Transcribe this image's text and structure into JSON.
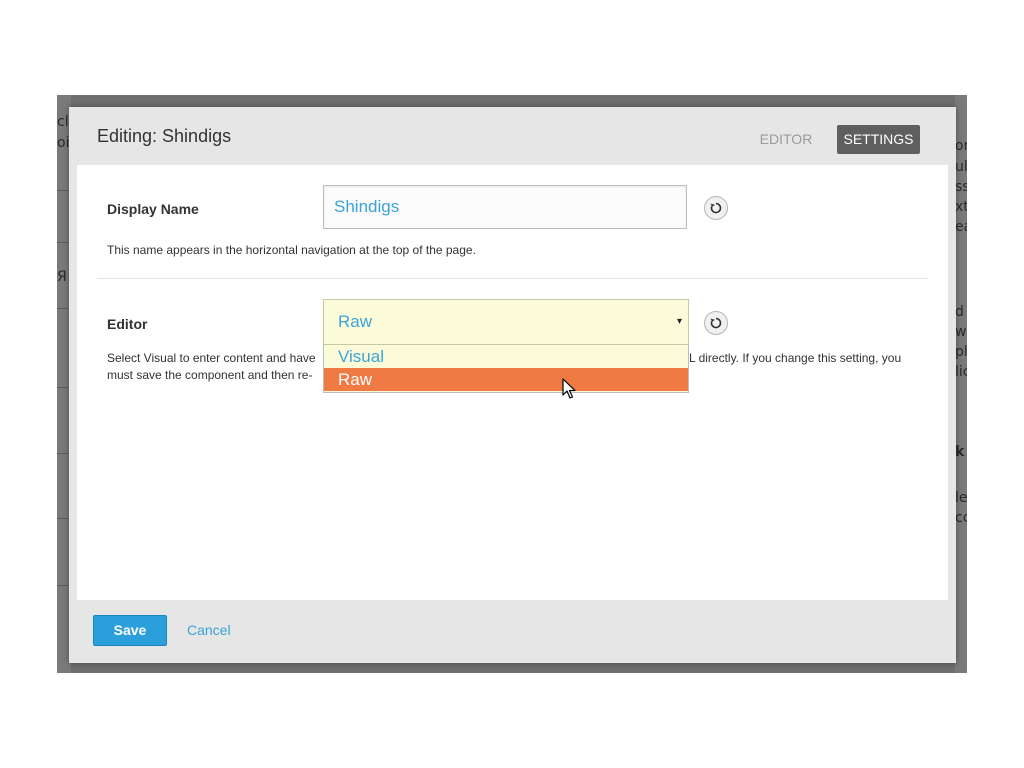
{
  "background": {
    "left_fragments": [
      "cl",
      "oi",
      "Я"
    ],
    "right_fragments": [
      "or",
      "ul",
      "ss",
      "xt",
      "ea",
      "d",
      "wi",
      "pl",
      "lic",
      "k",
      "le",
      "cc"
    ]
  },
  "modal": {
    "title": "Editing: Shindigs",
    "tabs": [
      {
        "label": "EDITOR",
        "active": false
      },
      {
        "label": "SETTINGS",
        "active": true
      }
    ]
  },
  "fields": {
    "display_name": {
      "label": "Display Name",
      "value": "Shindigs",
      "help": "This name appears in the horizontal navigation at the top of the page."
    },
    "editor": {
      "label": "Editor",
      "selected": "Raw",
      "options": [
        "Visual",
        "Raw"
      ],
      "help_line1_left": "Select Visual to enter content and have",
      "help_line1_right": "L directly. If you change this setting, you",
      "help_line2_left": "must save the component and then re-"
    }
  },
  "footer": {
    "save_label": "Save",
    "cancel_label": "Cancel"
  },
  "icons": {
    "reset": "reset-icon",
    "dropdown_arrow": "▾"
  },
  "colors": {
    "accent": "#2b9fdb",
    "link": "#3ba3d9",
    "highlight": "#ef7a44",
    "select_bg": "#fcfbd9"
  }
}
